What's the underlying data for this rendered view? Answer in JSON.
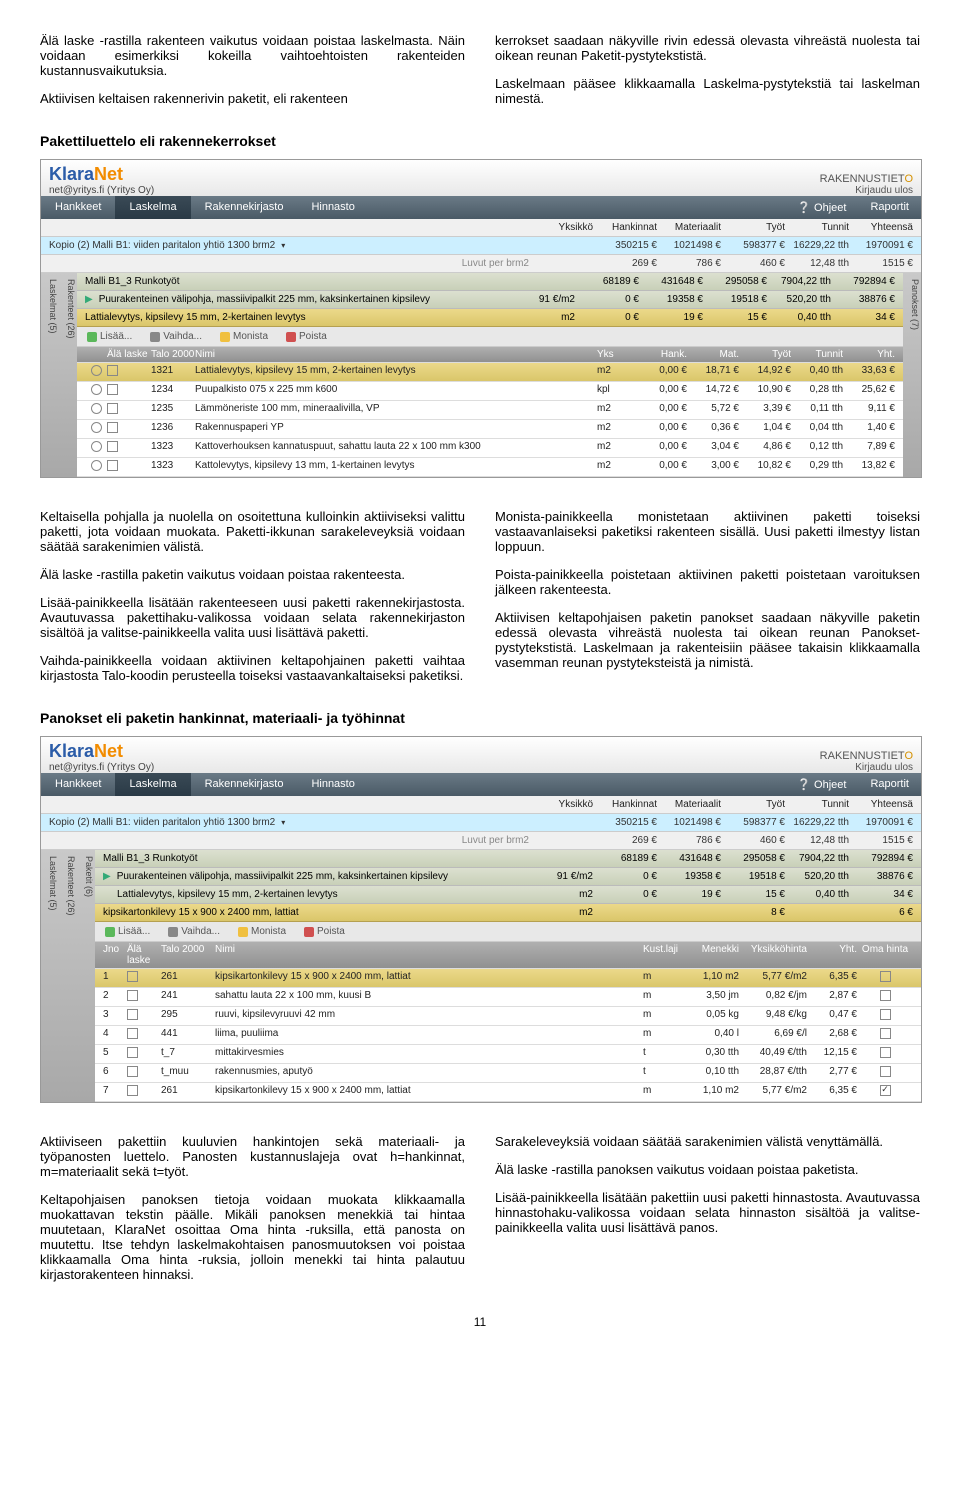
{
  "intro_left_p1": "Älä laske -rastilla rakenteen vaikutus voidaan poistaa laskelmasta. Näin voidaan esimerkiksi kokeilla vaihto­ehtoisten rakenteiden kustannusvaikutuksia.",
  "intro_left_p2": "Aktiivisen keltaisen rakennerivin paketit, eli rakenteen",
  "intro_right_p1": "kerrokset saadaan näkyville rivin edessä olevasta vihre­ästä nuolesta tai oikean reunan Paketit-pystytekstistä.",
  "intro_right_p2": "Laskelmaan pääsee klikkaamalla Laskelma-pystyteks­tiä tai laskelman nimestä.",
  "sec1_head": "Pakettiluettelo eli rakennekerrokset",
  "app": {
    "logo_k": "Klara",
    "logo_n": "Net",
    "company": "net@yritys.fi (Yritys Oy)",
    "rt_brand": "RAKENNUSTIET",
    "rt_o": "O",
    "logout": "Kirjaudu ulos",
    "nav": {
      "hankkeet": "Hankkeet",
      "laskelma": "Laskelma",
      "rakenne": "Rakennekirjasto",
      "hinnasto": "Hinnasto",
      "ohjeet": "Ohjeet",
      "raportit": "Raportit"
    },
    "sumhead": {
      "yksikko": "Yksikkö",
      "hank": "Hankinnat",
      "mat": "Materiaalit",
      "tyot": "Työt",
      "tunnit": "Tunnit",
      "yht": "Yhteensä"
    },
    "proj_name": "Kopio (2) Malli B1: viiden paritalon yhtiö 1300 brm2",
    "proj_vals": [
      "",
      "350215 €",
      "1021498 €",
      "598377 €",
      "16229,22 tth",
      "1970091 €"
    ],
    "brm2_label": "Luvut per brm2",
    "brm2_vals": [
      "",
      "269 €",
      "786 €",
      "460 €",
      "12,48 tth",
      "1515 €"
    ],
    "side_l1": "Laskelmat (5)",
    "side_l2": "Rakenteet (26)",
    "side_r": "Panokset (7)",
    "malli": "Malli B1_3 Runkotyöt",
    "malli_vals": [
      "",
      "68189 €",
      "431648 €",
      "295058 €",
      "7904,22 tth",
      "792894 €"
    ],
    "rakenne": "Puurakenteinen välipohja, massiivipalkit 225 mm, kaksinkertainen kipsilevy",
    "rakenne_vals": [
      "91 €/m2",
      "0 €",
      "19358 €",
      "19518 €",
      "520,20 tth",
      "38876 €"
    ],
    "paketti": "Lattialevytys, kipsilevy 15 mm, 2-kertainen levytys",
    "paketti_vals": [
      "m2",
      "0 €",
      "19 €",
      "15 €",
      "0,40 tth",
      "34 €"
    ],
    "toolbar": {
      "add": "Lisää...",
      "edit": "Vaihda...",
      "copy": "Monista",
      "del": "Poista"
    },
    "th1": {
      "ala": "Älä laske",
      "talo": "Talo 2000",
      "nimi": "Nimi",
      "yks": "Yks",
      "hank": "Hank.",
      "mat": "Mat.",
      "tyot": "Työt",
      "tun": "Tunnit",
      "yht": "Yht."
    },
    "rows1": [
      {
        "t": "1321",
        "n": "Lattialevytys, kipsilevy 15 mm, 2-kertainen levytys",
        "y": "m2",
        "h": "0,00 €",
        "m": "18,71 €",
        "ty": "14,92 €",
        "tu": "0,40 tth",
        "yh": "33,63 €",
        "sel": true
      },
      {
        "t": "1234",
        "n": "Puupalkisto 075 x 225 mm k600",
        "y": "kpl",
        "h": "0,00 €",
        "m": "14,72 €",
        "ty": "10,90 €",
        "tu": "0,28 tth",
        "yh": "25,62 €"
      },
      {
        "t": "1235",
        "n": "Lämmöneriste 100 mm, mineraalivilla, VP",
        "y": "m2",
        "h": "0,00 €",
        "m": "5,72 €",
        "ty": "3,39 €",
        "tu": "0,11 tth",
        "yh": "9,11 €"
      },
      {
        "t": "1236",
        "n": "Rakennuspaperi YP",
        "y": "m2",
        "h": "0,00 €",
        "m": "0,36 €",
        "ty": "1,04 €",
        "tu": "0,04 tth",
        "yh": "1,40 €"
      },
      {
        "t": "1323",
        "n": "Kattoverhouksen kannatuspuut, sahattu lauta 22 x 100 mm k300",
        "y": "m2",
        "h": "0,00 €",
        "m": "3,04 €",
        "ty": "4,86 €",
        "tu": "0,12 tth",
        "yh": "7,89 €"
      },
      {
        "t": "1323",
        "n": "Kattolevytys, kipsilevy 13 mm, 1-kertainen levytys",
        "y": "m2",
        "h": "0,00 €",
        "m": "3,00 €",
        "ty": "10,82 €",
        "tu": "0,29 tth",
        "yh": "13,82 €"
      }
    ]
  },
  "mid_left_p1": "Keltaisella pohjalla ja nuolella on osoitettuna kulloinkin aktiiviseksi valittu paketti, jota voidaan muokata. Paket­ti-ikkunan sarakeleveyksiä voidaan säätää sarakenimi­en välistä.",
  "mid_left_p2": "Älä laske -rastilla paketin vaikutus voidaan poistaa ra­kenteesta.",
  "mid_left_p3": "Lisää-painikkeella lisätään rakenteeseen uusi paketti rakennekirjastosta. Avautuvassa pakettihaku-valikossa voidaan selata rakennekirjaston sisältöä ja valitse-pai­nikkeella valita uusi lisättävä paketti.",
  "mid_left_p4": "Vaihda-painikkeella voidaan aktiivinen keltapohjainen paketti vaihtaa kirjastosta Talo-koodin perusteella toi­seksi vastaavankaltaiseksi paketiksi.",
  "mid_right_p1": "Monista-painikkeella monistetaan aktiivinen paketti toi­seksi vastaavanlaiseksi paketiksi rakenteen sisällä. Uusi paketti ilmestyy listan loppuun.",
  "mid_right_p2": "Poista-painikkeella poistetaan aktiivinen paketti poiste­taan varoituksen jälkeen rakenteesta.",
  "mid_right_p3": "Aktiivisen keltapohjaisen paketin panokset saadaan nä­kyville paketin edessä olevasta vihreästä nuolesta tai oikean reunan Panokset-pystytekstistä. Laskelmaan ja rakenteisiin pääsee takaisin klikkaamalla vasemman reunan pystyteksteistä ja nimistä.",
  "sec2_head": "Panokset eli paketin hankinnat, materiaali- ja työhinnat",
  "app2": {
    "side_l3": "Paketit (6)",
    "panos": "kipsikartonkilevy 15 x 900 x 2400 mm, lattiat",
    "panos_vals": [
      "m2",
      "",
      "",
      "8 €",
      "",
      "6 €"
    ],
    "th2": {
      "jno": "Jno",
      "ala": "Älä laske",
      "talo": "Talo 2000",
      "nimi": "Nimi",
      "laji": "Kust.laji",
      "men": "Menekki",
      "ykh": "Yksikköhinta",
      "yht": "Yht.",
      "oma": "Oma hinta"
    },
    "rows2": [
      {
        "j": "1",
        "t": "261",
        "n": "kipsikartonkilevy 15 x 900 x 2400 mm, lattiat",
        "l": "m",
        "m": "1,10 m2",
        "yk": "5,77 €/m2",
        "y": "6,35 €",
        "o": false,
        "sel": true
      },
      {
        "j": "2",
        "t": "241",
        "n": "sahattu lauta 22 x 100 mm, kuusi B",
        "l": "m",
        "m": "3,50 jm",
        "yk": "0,82 €/jm",
        "y": "2,87 €",
        "o": false
      },
      {
        "j": "3",
        "t": "295",
        "n": "ruuvi, kipsilevyruuvi 42 mm",
        "l": "m",
        "m": "0,05 kg",
        "yk": "9,48 €/kg",
        "y": "0,47 €",
        "o": false
      },
      {
        "j": "4",
        "t": "441",
        "n": "liima, puuliima",
        "l": "m",
        "m": "0,40 l",
        "yk": "6,69 €/l",
        "y": "2,68 €",
        "o": false
      },
      {
        "j": "5",
        "t": "t_7",
        "n": "mittakirvesmies",
        "l": "t",
        "m": "0,30 tth",
        "yk": "40,49 €/tth",
        "y": "12,15 €",
        "o": false
      },
      {
        "j": "6",
        "t": "t_muu",
        "n": "rakennusmies, aputyö",
        "l": "t",
        "m": "0,10 tth",
        "yk": "28,87 €/tth",
        "y": "2,77 €",
        "o": false
      },
      {
        "j": "7",
        "t": "261",
        "n": "kipsikartonkilevy 15 x 900 x 2400 mm, lattiat",
        "l": "m",
        "m": "1,10 m2",
        "yk": "5,77 €/m2",
        "y": "6,35 €",
        "o": true
      }
    ]
  },
  "end_left_p1": "Aktiiviseen pakettiin kuuluvien hankintojen sekä materi­aali- ja työpanosten luettelo. Panosten kustannuslajeja ovat h=hankinnat, m=materiaalit sekä t=työt.",
  "end_left_p2": "Keltapohjaisen panoksen tietoja voidaan muokata klik­kaamalla muokattavan tekstin päälle. Mikäli panoksen menekkiä tai hintaa muutetaan, KlaraNet osoittaa Oma hinta -ruksilla, että panosta on muutettu. Itse tehdyn laskelmakohtaisen panosmuutoksen voi poistaa klik­kaamalla Oma hinta -ruksia, jolloin menekki tai hinta palautuu kirjastorakenteen hinnaksi.",
  "end_right_p1": "Sarakeleveyksiä voidaan säätää sarakenimien välistä venyttämällä.",
  "end_right_p2": "Älä laske -rastilla panoksen vaikutus voidaan poistaa paketista.",
  "end_right_p3": "Lisää-painikkeella lisätään pakettiin uusi paketti hinnas­tosta. Avautuvassa hinnastohaku-valikossa voidaan se­lata hinnaston sisältöä ja valitse-painikkeella valita uusi lisättävä panos.",
  "pagenum": "11"
}
